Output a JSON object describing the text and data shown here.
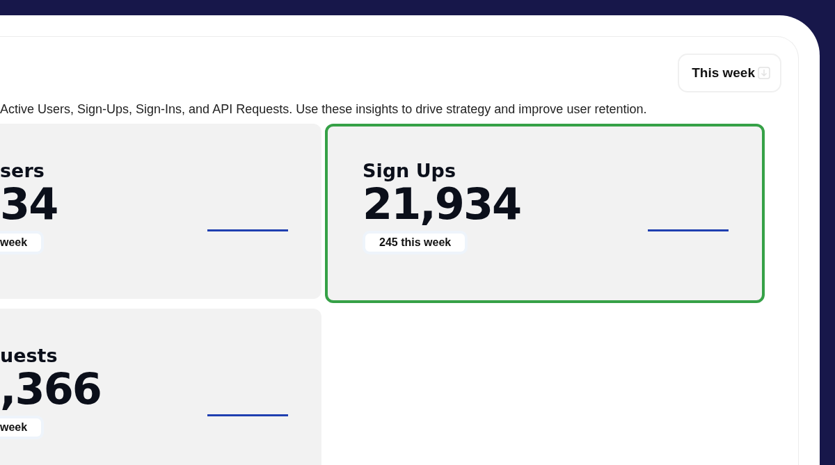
{
  "period_button": {
    "label": "This week"
  },
  "description": "Active Users, Sign-Ups, Sign-Ins, and API Requests. Use these insights to drive strategy and improve user retention.",
  "cards": [
    {
      "title": "sers",
      "value": "34",
      "badge": "week",
      "selected": false,
      "cut": true
    },
    {
      "title": "Sign Ups",
      "value": "21,934",
      "badge": "245 this week",
      "selected": true,
      "cut": false
    },
    {
      "title": "uests",
      "value": ",366",
      "badge": "week",
      "selected": false,
      "cut": true
    }
  ]
}
